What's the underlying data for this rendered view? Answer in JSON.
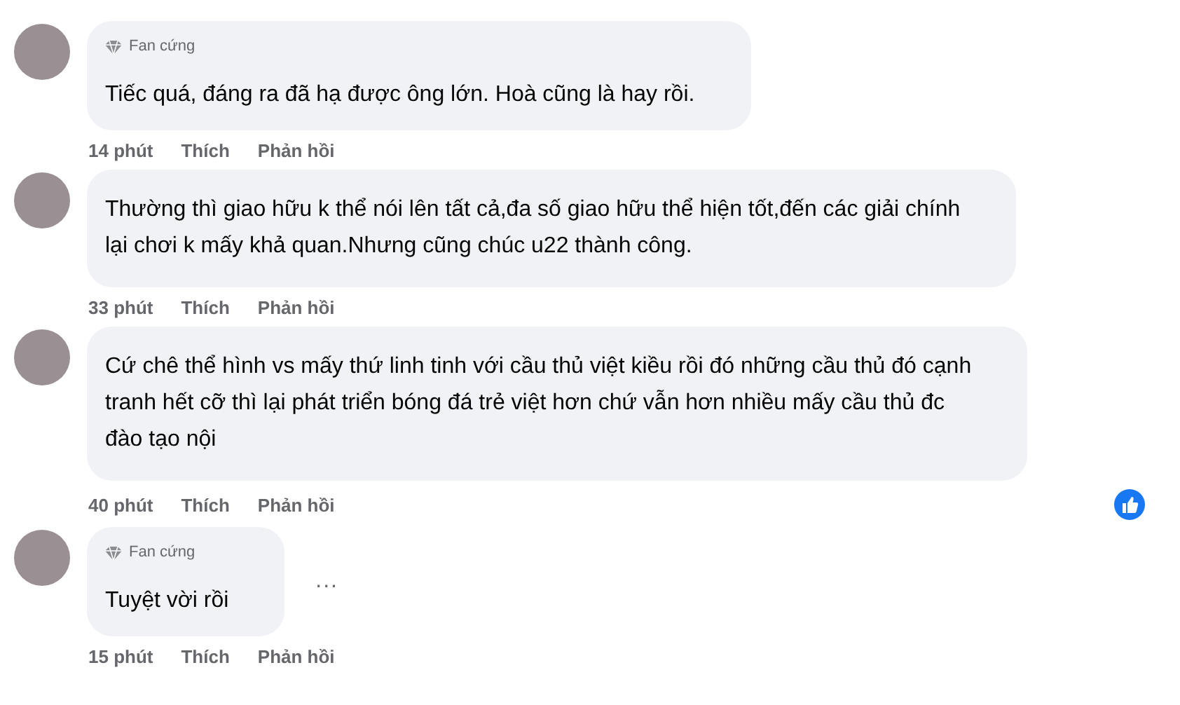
{
  "comments": [
    {
      "badge": "Fan cứng",
      "lines": [
        "Tiếc quá, đáng ra đã hạ được ông lớn. Hoà cũng là hay rồi."
      ],
      "time": "14 phút",
      "like": "Thích",
      "reply": "Phản hồi",
      "reaction_icon": false
    },
    {
      "lines": [
        "Thường thì giao hữu k thể nói lên tất cả,đa số giao hữu thể hiện tốt,đến các giải chính",
        "lại chơi k mấy khả quan.Nhưng cũng chúc u22 thành công."
      ],
      "time": "33 phút",
      "like": "Thích",
      "reply": "Phản hồi",
      "reaction_icon": false
    },
    {
      "lines": [
        "Cứ chê thể hình vs mấy thứ linh tinh với cầu thủ việt kiều rồi đó những cầu thủ đó cạnh",
        "tranh hết cỡ thì lại phát triển bóng đá trẻ việt hơn chứ vẫn hơn nhiều mấy cầu thủ đc",
        "đào tạo nội"
      ],
      "time": "40 phút",
      "like": "Thích",
      "reply": "Phản hồi",
      "reaction_icon": true
    },
    {
      "badge": "Fan cứng",
      "lines": [
        "Tuyệt vời rồi"
      ],
      "more": "...",
      "time": "15 phút",
      "like": "Thích",
      "reply": "Phản hồi",
      "reaction_icon": false
    }
  ]
}
